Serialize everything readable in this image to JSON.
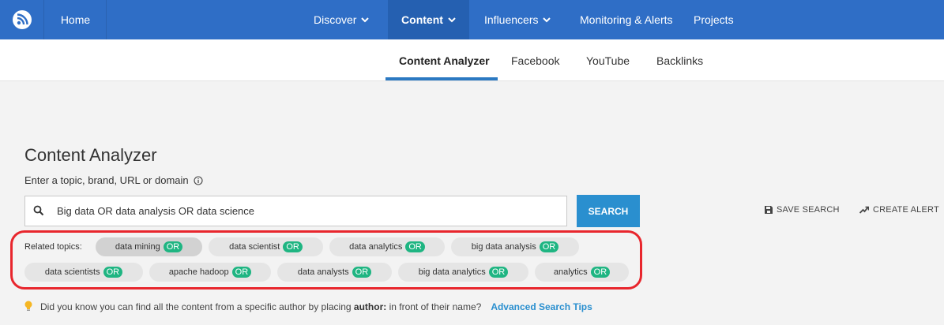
{
  "nav": {
    "home": "Home",
    "discover": "Discover",
    "content": "Content",
    "influencers": "Influencers",
    "monitoring": "Monitoring & Alerts",
    "projects": "Projects"
  },
  "subnav": {
    "content_analyzer": "Content Analyzer",
    "facebook": "Facebook",
    "youtube": "YouTube",
    "backlinks": "Backlinks"
  },
  "main": {
    "title": "Content Analyzer",
    "subtitle": "Enter a topic, brand, URL or domain",
    "search_value": "Big data OR data analysis OR data science",
    "search_button": "SEARCH",
    "save_search": "SAVE SEARCH",
    "create_alert": "CREATE ALERT"
  },
  "related": {
    "label": "Related topics:",
    "or_label": "OR",
    "row1": [
      "data mining",
      "data scientist",
      "data analytics",
      "big data analysis"
    ],
    "row2": [
      "data scientists",
      "apache hadoop",
      "data analysts",
      "big data analytics",
      "analytics"
    ]
  },
  "tip": {
    "text_before": "Did you know you can find all the content from a specific author by placing",
    "author": "author:",
    "text_after": "in front of their name?",
    "link": "Advanced Search Tips"
  },
  "colors": {
    "nav_bg": "#2f6ec6",
    "accent": "#2a8fcf",
    "or_badge": "#1fb582",
    "highlight": "#e8262d"
  }
}
